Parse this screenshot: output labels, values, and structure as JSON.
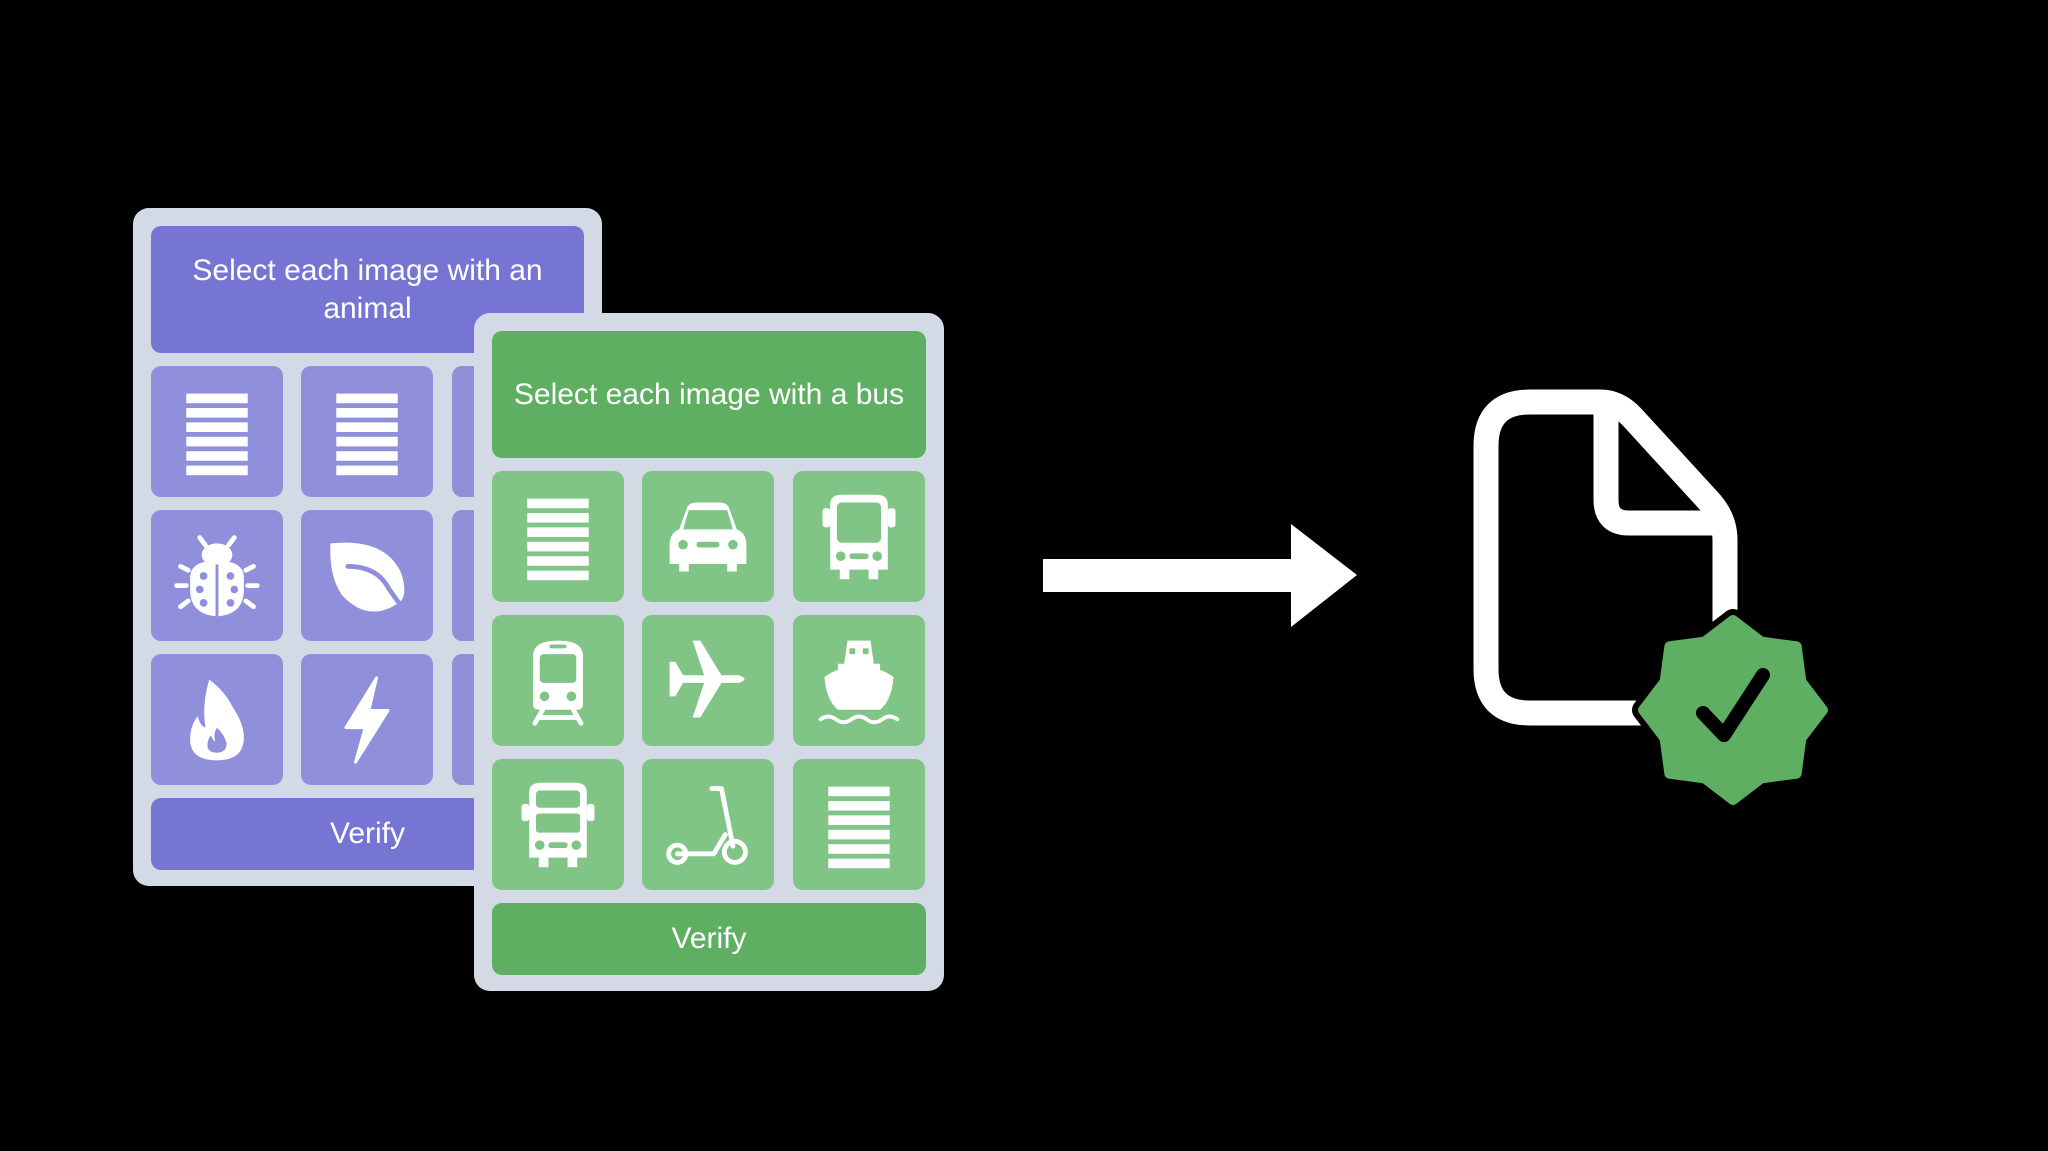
{
  "colors": {
    "background": "#000000",
    "panel_frame": "#D3DAE6",
    "purple_primary": "#7675D4",
    "purple_tile": "#908FDC",
    "green_primary": "#5FAF63",
    "green_tile": "#80C586",
    "icon": "#FFFFFF",
    "badge": "#5FAF63"
  },
  "animal_captcha": {
    "prompt": "Select each image with an animal",
    "verify_label": "Verify",
    "tiles": [
      {
        "icon": "text-lines-icon"
      },
      {
        "icon": "text-lines-icon"
      },
      {
        "icon": "hidden"
      },
      {
        "icon": "ladybug-icon"
      },
      {
        "icon": "leaf-icon"
      },
      {
        "icon": "hidden"
      },
      {
        "icon": "flame-icon"
      },
      {
        "icon": "bolt-icon"
      },
      {
        "icon": "hidden"
      }
    ]
  },
  "bus_captcha": {
    "prompt": "Select each image with a bus",
    "verify_label": "Verify",
    "tiles": [
      {
        "icon": "text-lines-icon"
      },
      {
        "icon": "car-icon"
      },
      {
        "icon": "bus-icon"
      },
      {
        "icon": "tram-icon"
      },
      {
        "icon": "airplane-icon"
      },
      {
        "icon": "ferry-icon"
      },
      {
        "icon": "bus-double-decker-icon"
      },
      {
        "icon": "scooter-icon"
      },
      {
        "icon": "text-lines-icon"
      }
    ]
  },
  "flow": {
    "arrow": "right-arrow-icon",
    "result": "verified-document-icon"
  }
}
